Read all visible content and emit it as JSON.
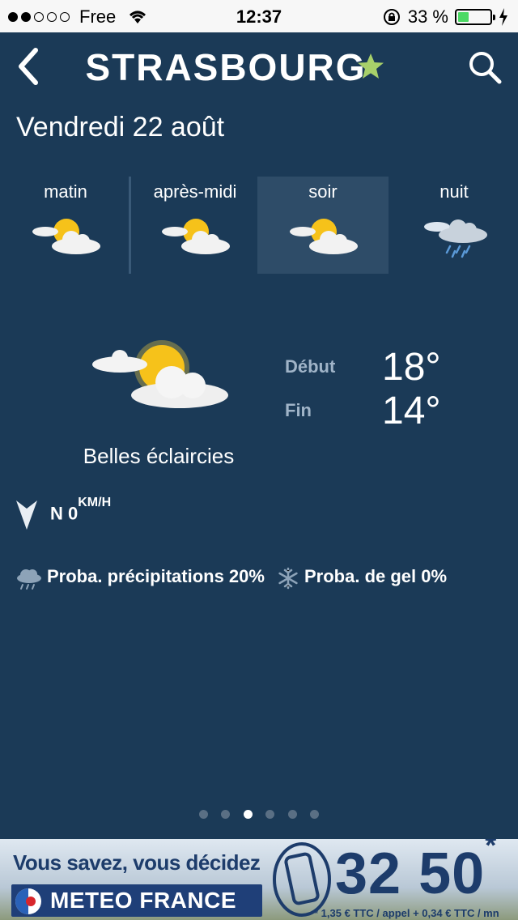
{
  "status_bar": {
    "carrier": "Free",
    "time": "12:37",
    "battery": "33 %",
    "battery_level": 0.33,
    "signal_bars": 2
  },
  "header": {
    "title": "STRASBOURG"
  },
  "date": "Vendredi 22 août",
  "periods": [
    {
      "label": "matin",
      "icon": "partly-sunny-icon",
      "selected": false
    },
    {
      "label": "après-midi",
      "icon": "partly-sunny-icon",
      "selected": false
    },
    {
      "label": "soir",
      "icon": "partly-sunny-icon",
      "selected": true
    },
    {
      "label": "nuit",
      "icon": "rain-cloud-icon",
      "selected": false
    }
  ],
  "main": {
    "description": "Belles éclaircies",
    "start_label": "Début",
    "start_temp": "18°",
    "end_label": "Fin",
    "end_temp": "14°",
    "wind": "N 0",
    "wind_unit": "KM/H",
    "precip": "Proba. précipitations 20%",
    "frost": "Proba. de gel 0%"
  },
  "pager": {
    "count": 6,
    "active": 2
  },
  "ad": {
    "line1": "Vous savez, vous décidez",
    "brand": "METEO FRANCE",
    "number": "32 50",
    "number_mark": "*",
    "fine_print": "* 1,35 € TTC / appel + 0,34 € TTC / mn"
  },
  "colors": {
    "background": "#1b3a57",
    "selected_period": "#2e4c68",
    "star": "#a8d06a",
    "muted_label": "#a0b4c8"
  }
}
